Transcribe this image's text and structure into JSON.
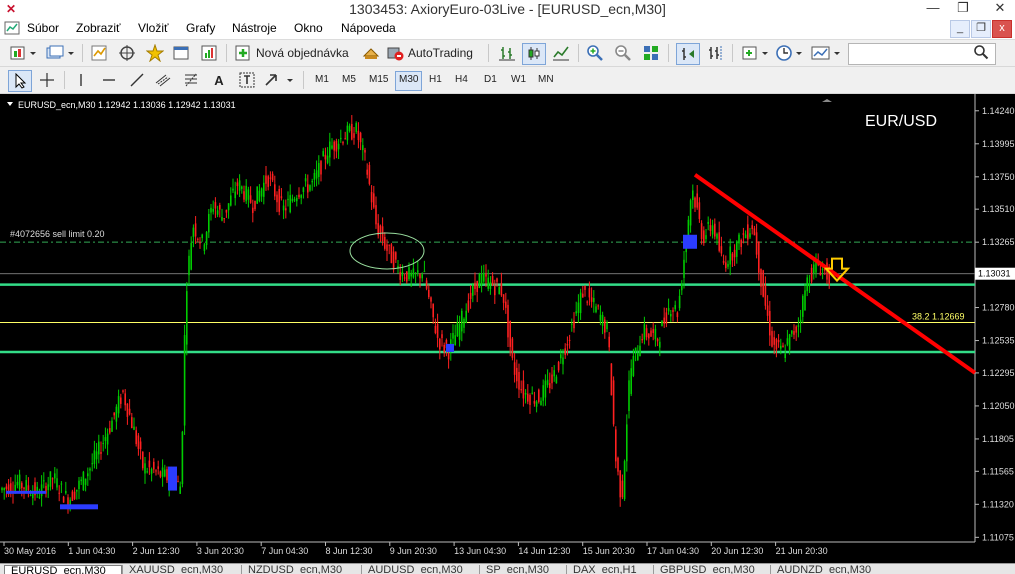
{
  "window": {
    "title": "1303453: AxioryEuro-03Live - [EURUSD_ecn,M30]",
    "minimize_glyph": "—",
    "restore_glyph": "❐",
    "close_glyph": "✕"
  },
  "menu": {
    "items": [
      "Súbor",
      "Zobraziť",
      "Vložiť",
      "Grafy",
      "Nástroje",
      "Okno",
      "Nápoveda"
    ],
    "mdi_minimize": "_",
    "mdi_restore": "❐",
    "mdi_close": "x"
  },
  "toolbar": {
    "new_order_label": "Nová objednávka",
    "autotrading_label": "AutoTrading",
    "search_placeholder": ""
  },
  "timeframes": [
    "M1",
    "M5",
    "M15",
    "M30",
    "H1",
    "H4",
    "D1",
    "W1",
    "MN"
  ],
  "active_timeframe": "M30",
  "chart": {
    "header": "EURUSD_ecn,M30  1.12942 1.13036 1.12942 1.13031",
    "symbol_label": "EUR/USD",
    "order_label": "#4072656 sell limit 0.20",
    "fib_label": "38.2",
    "fib_price": "1.12669",
    "current_price": "1.13031",
    "colors": {
      "background": "#000000",
      "bull": "#00cc00",
      "bear": "#ff2020",
      "level": "#33dd88",
      "trendline": "#ff0000",
      "fib": "#ffff66",
      "arrow": "#ffcc00"
    }
  },
  "chart_data": {
    "type": "candlestick",
    "symbol": "EURUSD_ecn",
    "timeframe": "M30",
    "ylim": [
      1.1107,
      1.1432
    ],
    "y_ticks": [
      "1.14240",
      "1.13995",
      "1.13750",
      "1.13510",
      "1.13265",
      "1.13031",
      "1.12780",
      "1.12535",
      "1.12295",
      "1.12050",
      "1.11805",
      "1.11565",
      "1.11320",
      "1.11075"
    ],
    "x_ticks": [
      "30 May 2016",
      "1 Jun 04:30",
      "2 Jun 12:30",
      "3 Jun 20:30",
      "7 Jun 04:30",
      "8 Jun 12:30",
      "9 Jun 20:30",
      "13 Jun 04:30",
      "14 Jun 12:30",
      "15 Jun 20:30",
      "17 Jun 04:30",
      "20 Jun 12:30",
      "21 Jun 20:30"
    ],
    "path": [
      [
        0,
        1.1142
      ],
      [
        20,
        1.1148
      ],
      [
        40,
        1.114
      ],
      [
        55,
        1.1152
      ],
      [
        70,
        1.1135
      ],
      [
        85,
        1.115
      ],
      [
        100,
        1.117
      ],
      [
        115,
        1.1195
      ],
      [
        125,
        1.1215
      ],
      [
        135,
        1.119
      ],
      [
        145,
        1.116
      ],
      [
        160,
        1.1155
      ],
      [
        175,
        1.115
      ],
      [
        183,
        1.1145
      ],
      [
        188,
        1.129
      ],
      [
        195,
        1.134
      ],
      [
        205,
        1.1325
      ],
      [
        215,
        1.1355
      ],
      [
        225,
        1.1345
      ],
      [
        240,
        1.137
      ],
      [
        255,
        1.1355
      ],
      [
        270,
        1.1375
      ],
      [
        285,
        1.135
      ],
      [
        300,
        1.1365
      ],
      [
        315,
        1.137
      ],
      [
        330,
        1.1395
      ],
      [
        345,
        1.1405
      ],
      [
        358,
        1.141
      ],
      [
        368,
        1.1385
      ],
      [
        378,
        1.134
      ],
      [
        390,
        1.132
      ],
      [
        402,
        1.1305
      ],
      [
        415,
        1.13
      ],
      [
        425,
        1.1305
      ],
      [
        432,
        1.128
      ],
      [
        440,
        1.1255
      ],
      [
        450,
        1.1245
      ],
      [
        462,
        1.1265
      ],
      [
        472,
        1.1285
      ],
      [
        482,
        1.13
      ],
      [
        495,
        1.1295
      ],
      [
        505,
        1.129
      ],
      [
        515,
        1.1235
      ],
      [
        525,
        1.1215
      ],
      [
        540,
        1.121
      ],
      [
        555,
        1.1225
      ],
      [
        570,
        1.1255
      ],
      [
        585,
        1.129
      ],
      [
        600,
        1.1275
      ],
      [
        610,
        1.126
      ],
      [
        618,
        1.1165
      ],
      [
        624,
        1.1135
      ],
      [
        632,
        1.123
      ],
      [
        645,
        1.126
      ],
      [
        660,
        1.1255
      ],
      [
        672,
        1.128
      ],
      [
        680,
        1.1275
      ],
      [
        687,
        1.132
      ],
      [
        694,
        1.1368
      ],
      [
        705,
        1.133
      ],
      [
        715,
        1.134
      ],
      [
        725,
        1.131
      ],
      [
        740,
        1.1325
      ],
      [
        755,
        1.134
      ],
      [
        765,
        1.129
      ],
      [
        775,
        1.125
      ],
      [
        785,
        1.1245
      ],
      [
        800,
        1.1265
      ],
      [
        810,
        1.13
      ],
      [
        820,
        1.131
      ],
      [
        830,
        1.1302
      ]
    ],
    "horizontal_levels": [
      1.1295,
      1.1245
    ],
    "order_level": 1.13265,
    "fib_level": 1.12669,
    "trendline": [
      [
        695,
        1.13765
      ],
      [
        975,
        1.12295
      ]
    ]
  },
  "tabs": [
    "EURUSD_ecn,M30",
    "XAUUSD_ecn,M30",
    "NZDUSD_ecn,M30",
    "AUDUSD_ecn,M30",
    "SP_ecn,M30",
    "DAX_ecn,H1",
    "GBPUSD_ecn,M30",
    "AUDNZD_ecn,M30"
  ]
}
